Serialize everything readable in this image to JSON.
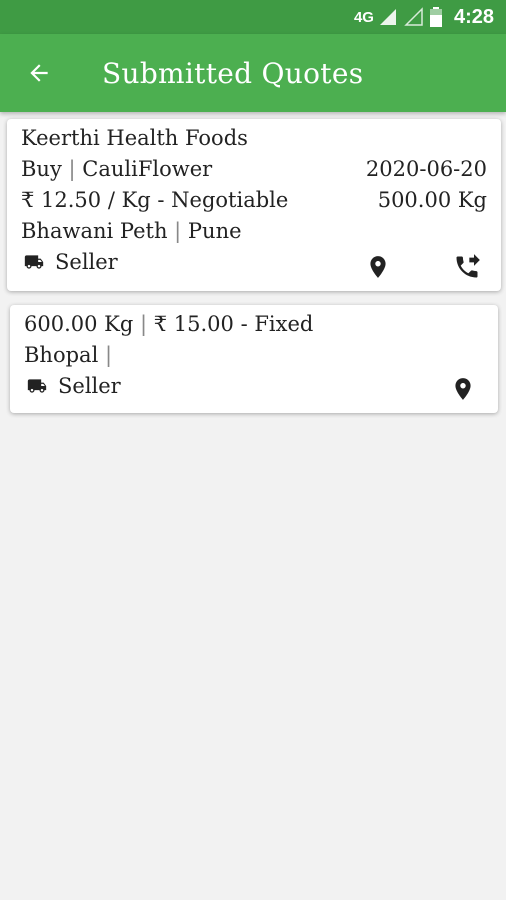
{
  "status_bar": {
    "network": "4G",
    "time": "4:28"
  },
  "app_bar": {
    "title": "Submitted Quotes",
    "back_icon": "arrow-back-icon"
  },
  "quotes": [
    {
      "company": "Keerthi Health Foods",
      "type": "Buy",
      "separator": "|",
      "product": "CauliFlower",
      "date": "2020-06-20",
      "price": "₹ 12.50 / Kg - Negotiable",
      "quantity": "500.00 Kg",
      "location_area": "Bhawani Peth",
      "location_city": "Pune",
      "role": "Seller"
    },
    {
      "quantity": "600.00 Kg",
      "separator": "|",
      "price": "₹ 15.00 - Fixed",
      "location_city": "Bhopal",
      "location_sep": "|",
      "role": "Seller"
    }
  ],
  "colors": {
    "status_bar": "#3f9b44",
    "app_bar": "#4caf50",
    "background": "#f2f2f2"
  }
}
